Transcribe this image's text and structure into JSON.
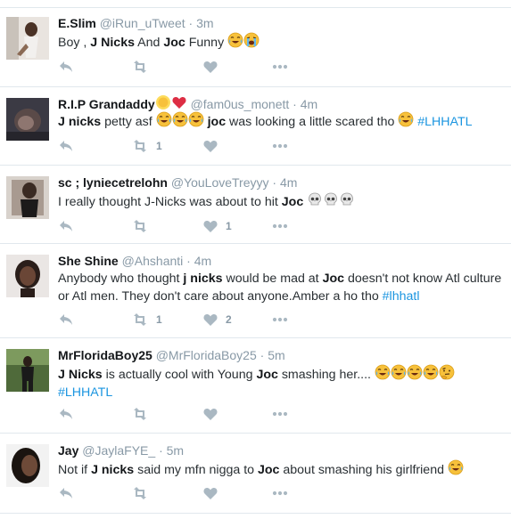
{
  "tweets": [
    {
      "name": "E.Slim",
      "handle": "@iRun_uTweet",
      "time": "3m",
      "parts": {
        "a": "Boy , ",
        "b": "J Nicks",
        "c": " And ",
        "d": "Joc",
        "e": " Funny "
      },
      "emojis": [
        "face-with-tears-of-joy",
        "loudly-crying-face"
      ],
      "retweet_count": "",
      "like_count": ""
    },
    {
      "name": "R.I.P Grandaddy",
      "name_emojis": [
        "sun-face",
        "red-heart"
      ],
      "handle": "@fam0us_monett",
      "time": "4m",
      "parts": {
        "a": "J nicks",
        "b": " petty asf ",
        "c": "joc",
        "d": " was looking a little scared tho ",
        "hashtag": "#LHHATL"
      },
      "emojis": [
        "face-with-tears-of-joy",
        "face-with-tears-of-joy",
        "face-with-tears-of-joy"
      ],
      "retweet_count": "1",
      "like_count": ""
    },
    {
      "name": "sc ; lyniecetrelohn",
      "handle": "@YouLoveTreyyy",
      "time": "4m",
      "parts": {
        "a": "I really thought J-Nicks was about to hit ",
        "b": "Joc"
      },
      "emojis": [
        "skull",
        "skull",
        "skull"
      ],
      "retweet_count": "",
      "like_count": "1"
    },
    {
      "name": "She Shine",
      "handle": "@Ahshanti",
      "time": "4m",
      "parts": {
        "a": "Anybody who thought ",
        "b": "j nicks",
        "c": " would be mad at ",
        "d": "Joc",
        "e": " doesn't not know Atl culture or Atl men. They don't care about anyone.Amber a ho tho ",
        "hashtag": "#lhhatl"
      },
      "retweet_count": "1",
      "like_count": "2"
    },
    {
      "name": "MrFloridaBoy25",
      "handle": "@MrFloridaBoy25",
      "time": "5m",
      "parts": {
        "a": "J Nicks",
        "b": " is actually cool with Young ",
        "c": "Joc",
        "d": " smashing her.... ",
        "hashtag": "#LHHATL"
      },
      "emojis": [
        "face-with-tears-of-joy",
        "face-with-tears-of-joy",
        "face-with-tears-of-joy",
        "face-with-tears-of-joy",
        "thinking-face"
      ],
      "retweet_count": "",
      "like_count": ""
    },
    {
      "name": "Jay",
      "handle": "@JaylaFYE_",
      "time": "5m",
      "parts": {
        "a": "Not if ",
        "b": "J nicks",
        "c": " said my mfn nigga to ",
        "d": "Joc",
        "e": " about smashing his girlfriend "
      },
      "emojis": [
        "face-with-tears-of-joy"
      ],
      "retweet_count": "",
      "like_count": ""
    }
  ],
  "colors": {
    "meta": "#8899a6",
    "hashtag": "#1b95e0",
    "name": "#14171a",
    "icon": "#aab8c2",
    "divider": "#e1e8ed"
  }
}
